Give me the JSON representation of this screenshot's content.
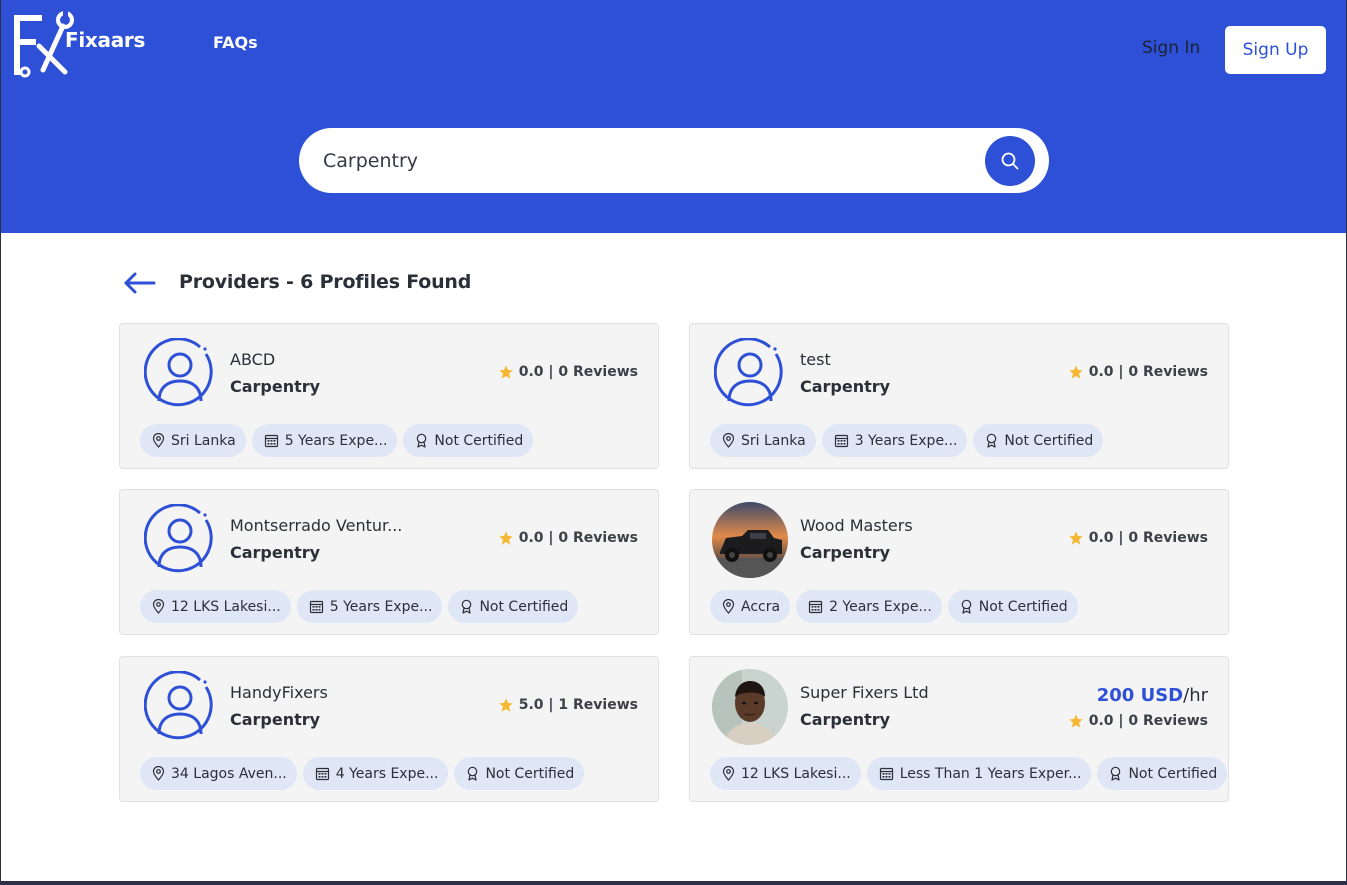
{
  "header": {
    "logo_text": "Fixaars",
    "nav_faqs": "FAQs",
    "sign_in": "Sign In",
    "sign_up": "Sign Up",
    "accent": "#2e50d6"
  },
  "search": {
    "value": "Carpentry",
    "icon": "search-icon"
  },
  "results": {
    "title": "Providers - 6 Profiles Found"
  },
  "providers": [
    {
      "name": "ABCD",
      "category": "Carpentry",
      "rating": "0.0 | 0 Reviews",
      "location": "Sri Lanka",
      "experience": "5 Years Expe...",
      "certification": "Not Certified"
    },
    {
      "name": "test",
      "category": "Carpentry",
      "rating": "0.0 | 0 Reviews",
      "location": "Sri Lanka",
      "experience": "3 Years Expe...",
      "certification": "Not Certified"
    },
    {
      "name": "Montserrado Ventur...",
      "category": "Carpentry",
      "rating": "0.0 | 0 Reviews",
      "location": "12 LKS Lakesi...",
      "experience": "5 Years Expe...",
      "certification": "Not Certified"
    },
    {
      "name": "Wood Masters",
      "category": "Carpentry",
      "rating": "0.0 | 0 Reviews",
      "location": "Accra",
      "experience": "2 Years Expe...",
      "certification": "Not Certified"
    },
    {
      "name": "HandyFixers",
      "category": "Carpentry",
      "rating": "5.0 | 1 Reviews",
      "location": "34 Lagos Aven...",
      "experience": "4 Years Expe...",
      "certification": "Not Certified"
    },
    {
      "name": "Super Fixers Ltd",
      "category": "Carpentry",
      "rating": "0.0 | 0 Reviews",
      "price_amount": "200 USD",
      "price_unit": "/hr",
      "location": "12 LKS Lakesi...",
      "experience": "Less Than 1 Years Exper...",
      "certification": "Not Certified"
    }
  ]
}
